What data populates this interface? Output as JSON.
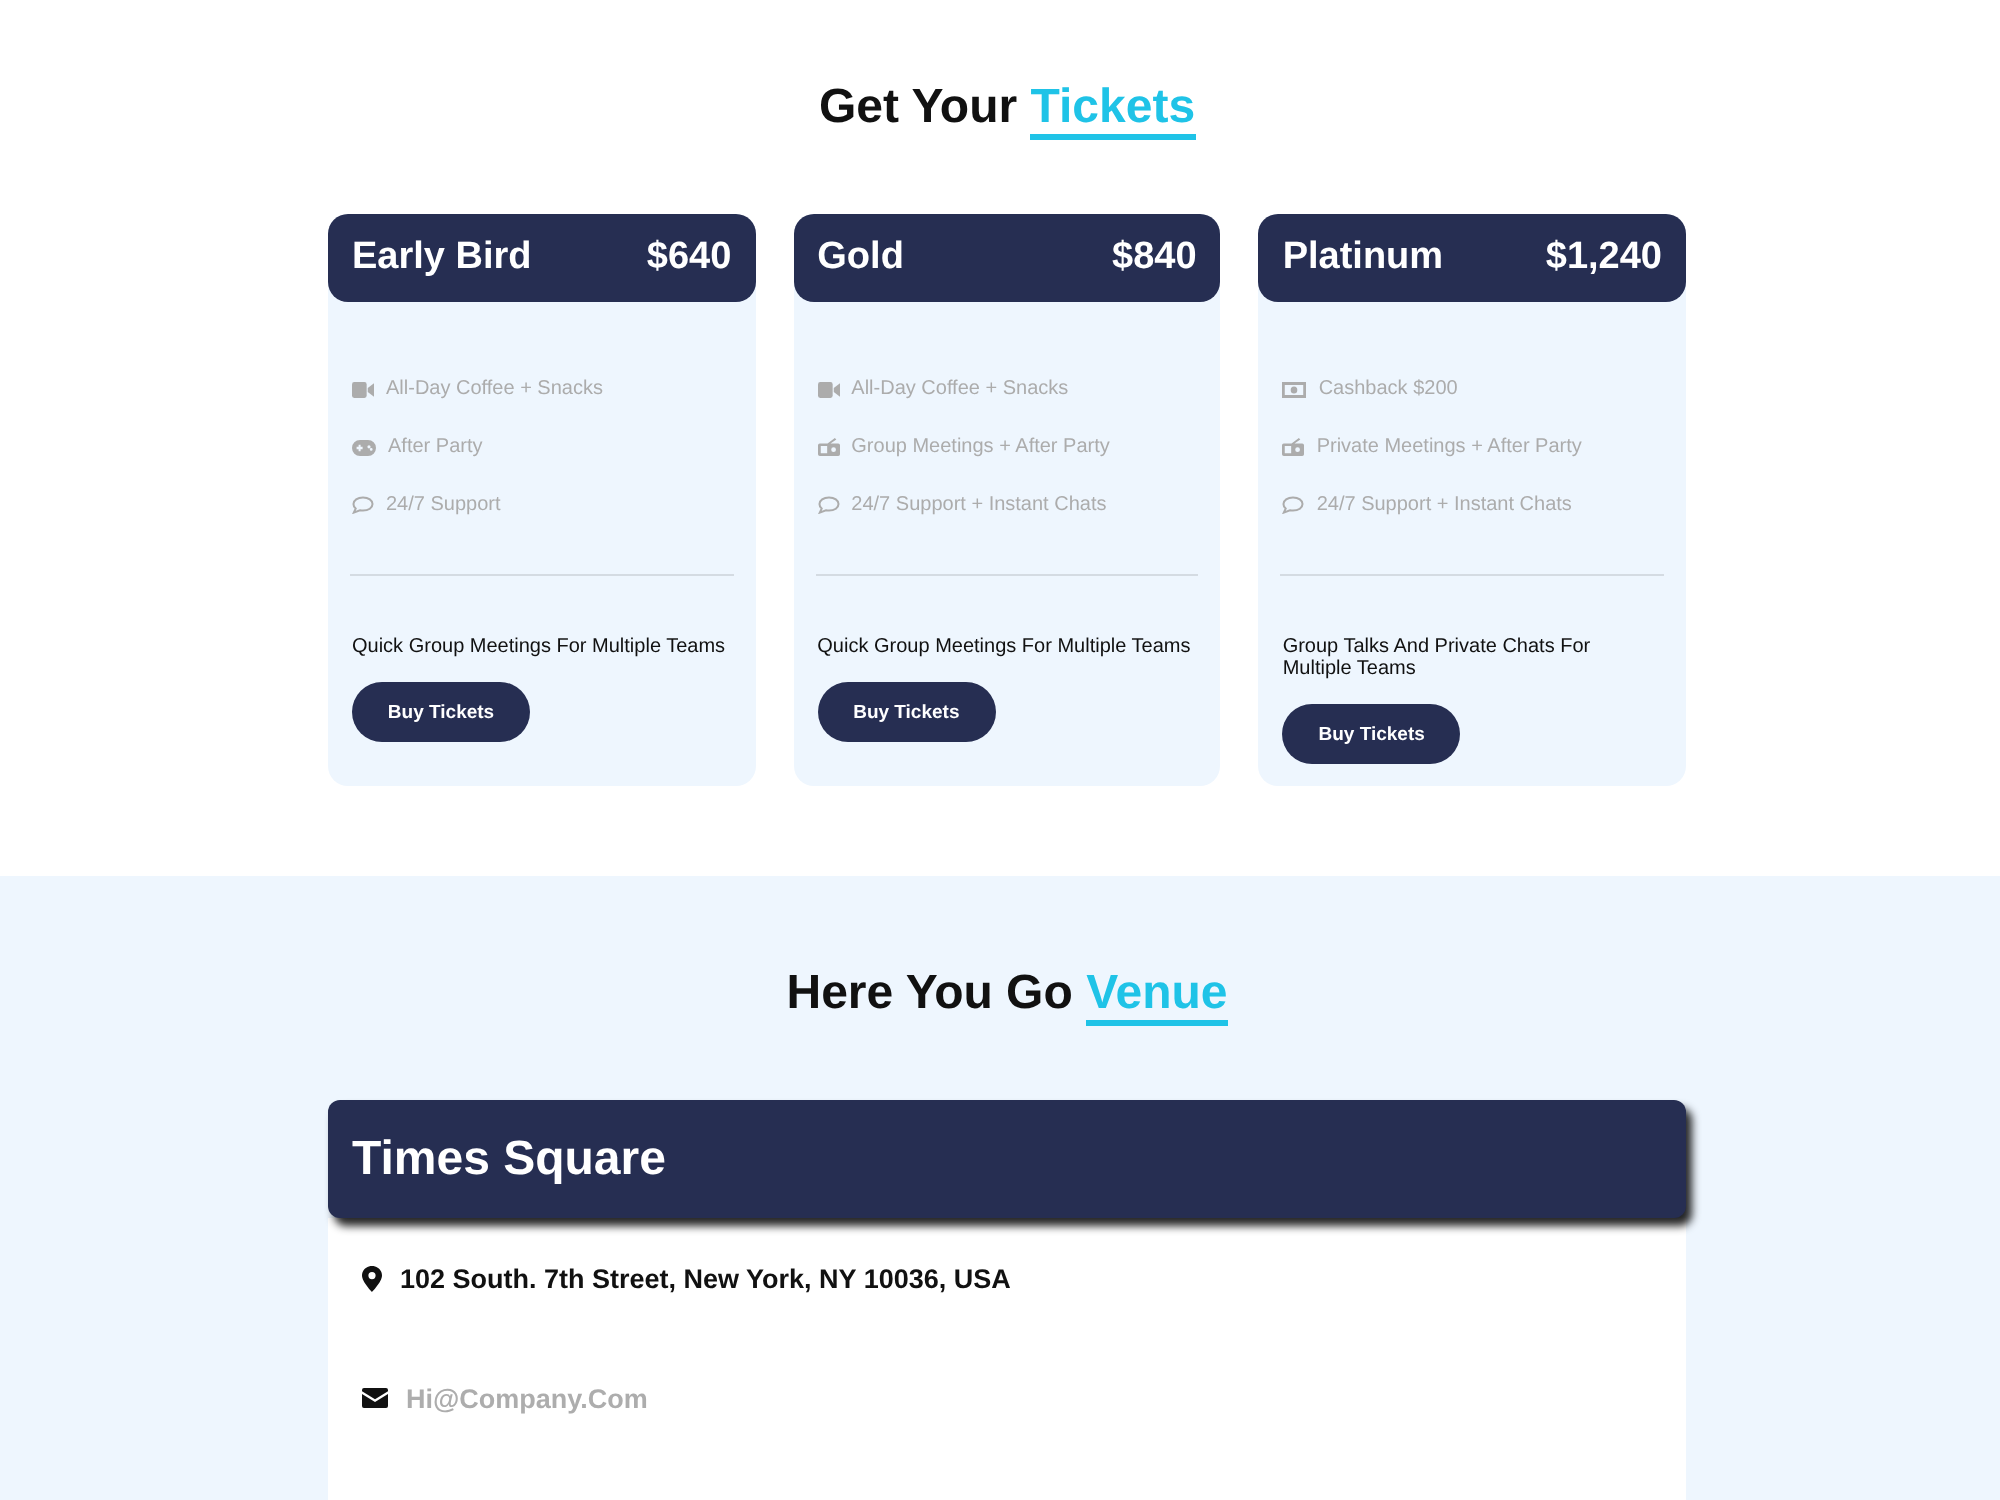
{
  "tickets_section": {
    "heading": {
      "title": "Get Your",
      "accent": "Tickets"
    },
    "plans": [
      {
        "name": "Early Bird",
        "price": "$640",
        "features": [
          {
            "kind": "video",
            "text": "All-Day Coffee + Snacks"
          },
          {
            "kind": "gamepad",
            "text": "After Party"
          },
          {
            "kind": "chat",
            "text": "24/7 Support"
          }
        ],
        "description": "Quick Group Meetings For Multiple Teams",
        "button": "Buy Tickets"
      },
      {
        "name": "Gold",
        "price": "$840",
        "features": [
          {
            "kind": "video",
            "text": "All-Day Coffee + Snacks"
          },
          {
            "kind": "radio",
            "text": "Group Meetings + After Party"
          },
          {
            "kind": "chat",
            "text": "24/7 Support + Instant Chats"
          }
        ],
        "description": "Quick Group Meetings For Multiple Teams",
        "button": "Buy Tickets"
      },
      {
        "name": "Platinum",
        "price": "$1,240",
        "features": [
          {
            "kind": "money",
            "text": "Cashback $200"
          },
          {
            "kind": "radio",
            "text": "Private Meetings + After Party"
          },
          {
            "kind": "chat",
            "text": "24/7 Support + Instant Chats"
          }
        ],
        "description": "Group Talks And Private Chats For Multiple Teams",
        "button": "Buy Tickets"
      }
    ]
  },
  "venue_section": {
    "heading": {
      "title": "Here You Go",
      "accent": "Venue"
    },
    "venue": {
      "name": "Times Square",
      "address": "102 South. 7th Street, New York, NY 10036, USA",
      "email": "Hi@Company.Com"
    }
  }
}
